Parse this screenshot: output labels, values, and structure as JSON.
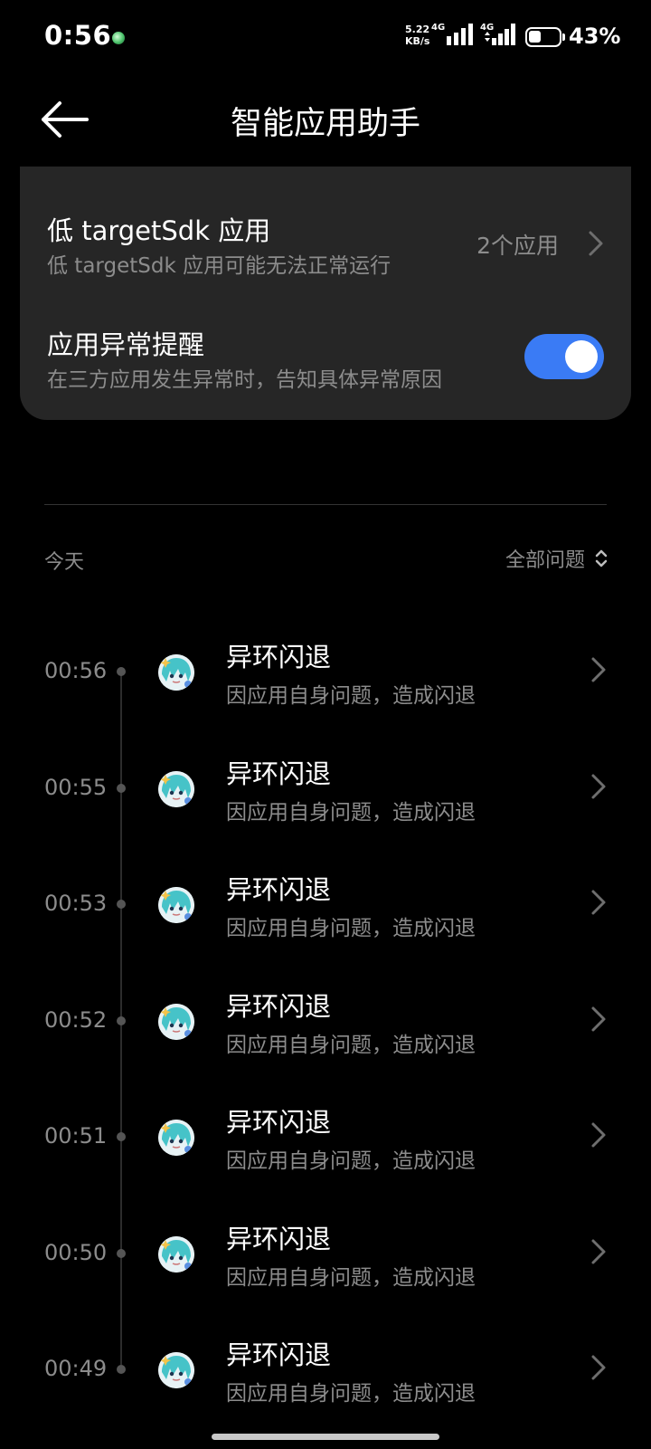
{
  "status_bar": {
    "time": "0:56",
    "net_speed_value": "5.22",
    "net_speed_unit": "KB/s",
    "sim1_label": "4G",
    "sim2_label": "4G",
    "battery_percent_text": "43%",
    "battery_level": 0.43
  },
  "header": {
    "title": "智能应用助手",
    "back_icon": "arrow-left-icon"
  },
  "settings": {
    "low_target_sdk": {
      "title": "低 targetSdk 应用",
      "subtitle": "低 targetSdk 应用可能无法正常运行",
      "value": "2个应用"
    },
    "crash_alert": {
      "title": "应用异常提醒",
      "subtitle": "在三方应用发生异常时，告知具体异常原因",
      "enabled": true,
      "accent_color": "#3a7bf5"
    }
  },
  "list": {
    "section_label": "今天",
    "filter_label": "全部问题",
    "entries": [
      {
        "time": "00:56",
        "title": "异环闪退",
        "subtitle": "因应用自身问题，造成闪退"
      },
      {
        "time": "00:55",
        "title": "异环闪退",
        "subtitle": "因应用自身问题，造成闪退"
      },
      {
        "time": "00:53",
        "title": "异环闪退",
        "subtitle": "因应用自身问题，造成闪退"
      },
      {
        "time": "00:52",
        "title": "异环闪退",
        "subtitle": "因应用自身问题，造成闪退"
      },
      {
        "time": "00:51",
        "title": "异环闪退",
        "subtitle": "因应用自身问题，造成闪退"
      },
      {
        "time": "00:50",
        "title": "异环闪退",
        "subtitle": "因应用自身问题，造成闪退"
      },
      {
        "time": "00:49",
        "title": "异环闪退",
        "subtitle": "因应用自身问题，造成闪退"
      }
    ]
  }
}
